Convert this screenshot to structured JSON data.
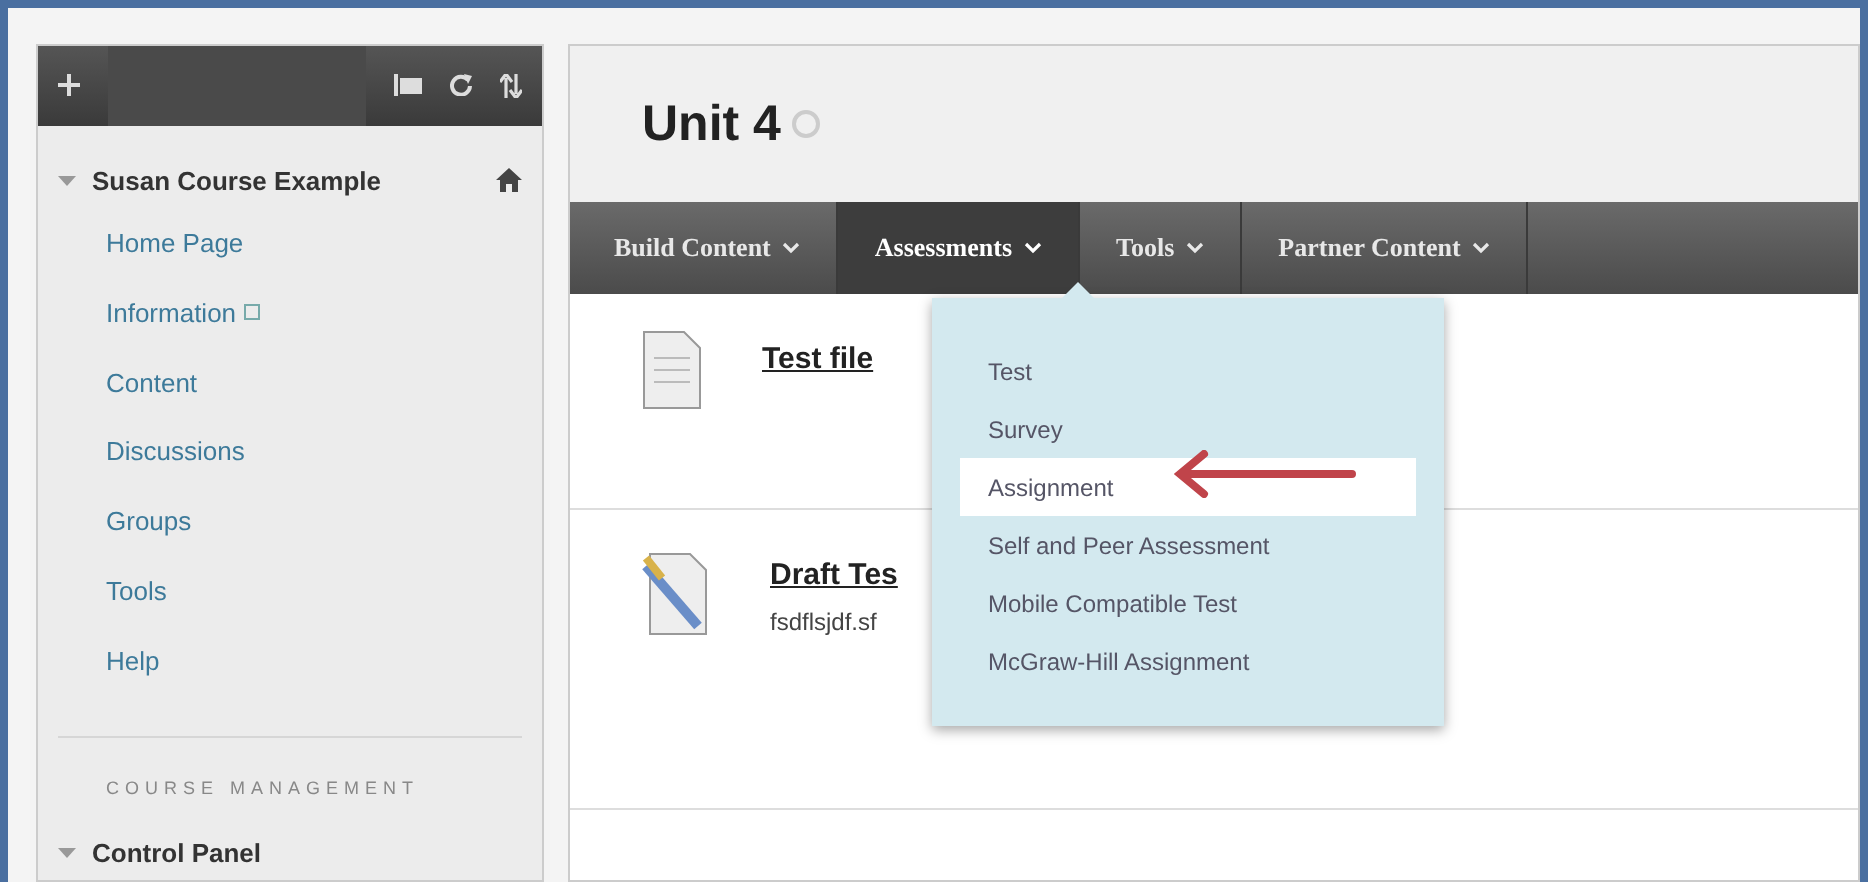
{
  "sidebar": {
    "course": {
      "title": "Susan Course Example",
      "expanded": true
    },
    "items": [
      {
        "label": "Home Page",
        "has_icon": false
      },
      {
        "label": "Information",
        "has_icon": true
      },
      {
        "label": "Content",
        "has_icon": false
      },
      {
        "label": "Discussions",
        "has_icon": false
      },
      {
        "label": "Groups",
        "has_icon": false
      },
      {
        "label": "Tools",
        "has_icon": false
      },
      {
        "label": "Help",
        "has_icon": false
      }
    ],
    "section_heading": "COURSE MANAGEMENT",
    "control_panel": {
      "title": "Control Panel",
      "expanded": true
    }
  },
  "page_title": "Unit 4",
  "tabs": [
    {
      "label": "Build Content",
      "selected": false
    },
    {
      "label": "Assessments",
      "selected": true
    },
    {
      "label": "Tools",
      "selected": false
    },
    {
      "label": "Partner Content",
      "selected": false
    }
  ],
  "content_items": [
    {
      "kind": "file",
      "title": "Test file"
    },
    {
      "kind": "test",
      "title": "Draft Tes",
      "description": "fsdflsjdf.sf"
    }
  ],
  "dropdown": {
    "items": [
      {
        "label": "Test",
        "selected": false
      },
      {
        "label": "Survey",
        "selected": false
      },
      {
        "label": "Assignment",
        "selected": true
      },
      {
        "label": "Self and Peer Assessment",
        "selected": false
      },
      {
        "label": "Mobile Compatible Test",
        "selected": false
      },
      {
        "label": "McGraw-Hill Assignment",
        "selected": false
      }
    ]
  }
}
